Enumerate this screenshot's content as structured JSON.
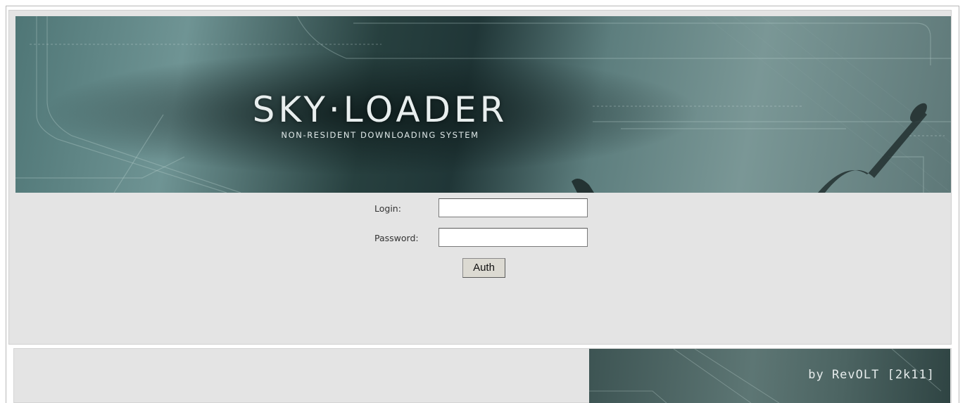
{
  "header": {
    "logo_title": "SKY·LOADER",
    "logo_subtitle": "NON-RESIDENT DOWNLOADING SYSTEM"
  },
  "login_form": {
    "login_label": "Login:",
    "login_value": "",
    "password_label": "Password:",
    "password_value": "",
    "submit_label": "Auth"
  },
  "footer": {
    "credit": "by RevOLT [2k11]"
  },
  "colors": {
    "panel_bg": "#e4e4e4",
    "banner_teal": "#4f7676",
    "button_bg": "#dcdad2"
  }
}
